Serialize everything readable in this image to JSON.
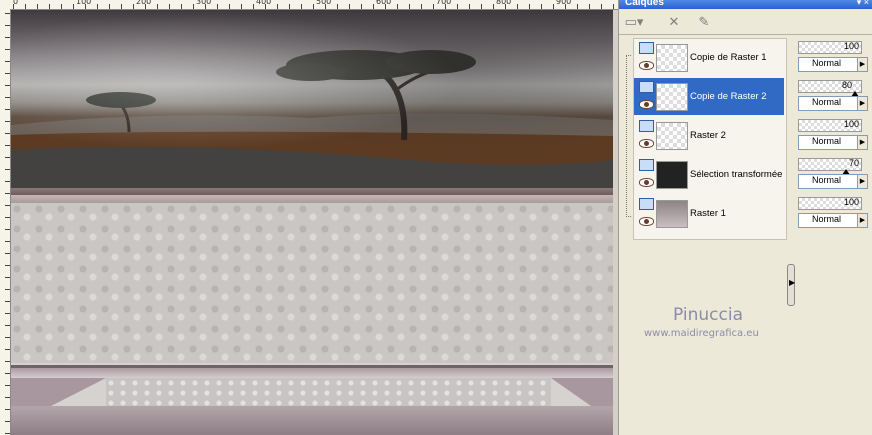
{
  "ruler": {
    "ticks": [
      "0",
      "100",
      "200",
      "300",
      "400",
      "500",
      "600",
      "700",
      "800",
      "900"
    ]
  },
  "panel": {
    "title": "Calques",
    "title_buttons": "▾ ×"
  },
  "layers": [
    {
      "name": "Copie de Raster 1",
      "selected": false,
      "opacity": "100",
      "blend": "Normal"
    },
    {
      "name": "Copie de Raster 2",
      "selected": true,
      "opacity": "80",
      "blend": "Normal"
    },
    {
      "name": "Raster 2",
      "selected": false,
      "opacity": "100",
      "blend": "Normal"
    },
    {
      "name": "Sélection transformée",
      "selected": false,
      "opacity": "70",
      "blend": "Normal"
    },
    {
      "name": "Raster 1",
      "selected": false,
      "opacity": "100",
      "blend": "Normal"
    }
  ],
  "watermark": {
    "name": "Pinuccia",
    "url": "www.maidiregrafica.eu"
  },
  "colors": {
    "selection": "#316ac5",
    "titlebar": "#2b62d0"
  }
}
